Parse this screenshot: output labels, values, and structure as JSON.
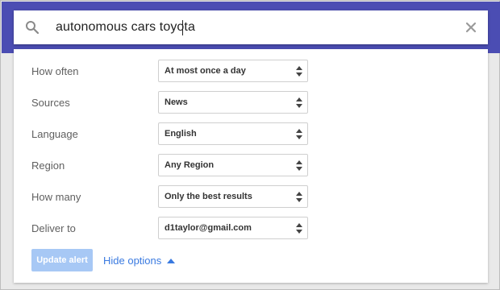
{
  "search": {
    "query": "autonomous cars toyota"
  },
  "settings": {
    "rows": [
      {
        "label": "How often",
        "value": "At most once a day"
      },
      {
        "label": "Sources",
        "value": "News"
      },
      {
        "label": "Language",
        "value": "English"
      },
      {
        "label": "Region",
        "value": "Any Region"
      },
      {
        "label": "How many",
        "value": "Only the best results"
      },
      {
        "label": "Deliver to",
        "value": "d1taylor@gmail.com"
      }
    ]
  },
  "actions": {
    "update_label": "Update alert",
    "hide_options_label": "Hide options"
  },
  "colors": {
    "header": "#4b4db3",
    "update_button": "#a7c8f5",
    "link": "#3a7ae0"
  },
  "icons": {
    "search": "search-icon",
    "clear": "close-icon",
    "select_arrows": "up-down-arrows-icon",
    "hide_caret": "caret-up-icon"
  }
}
